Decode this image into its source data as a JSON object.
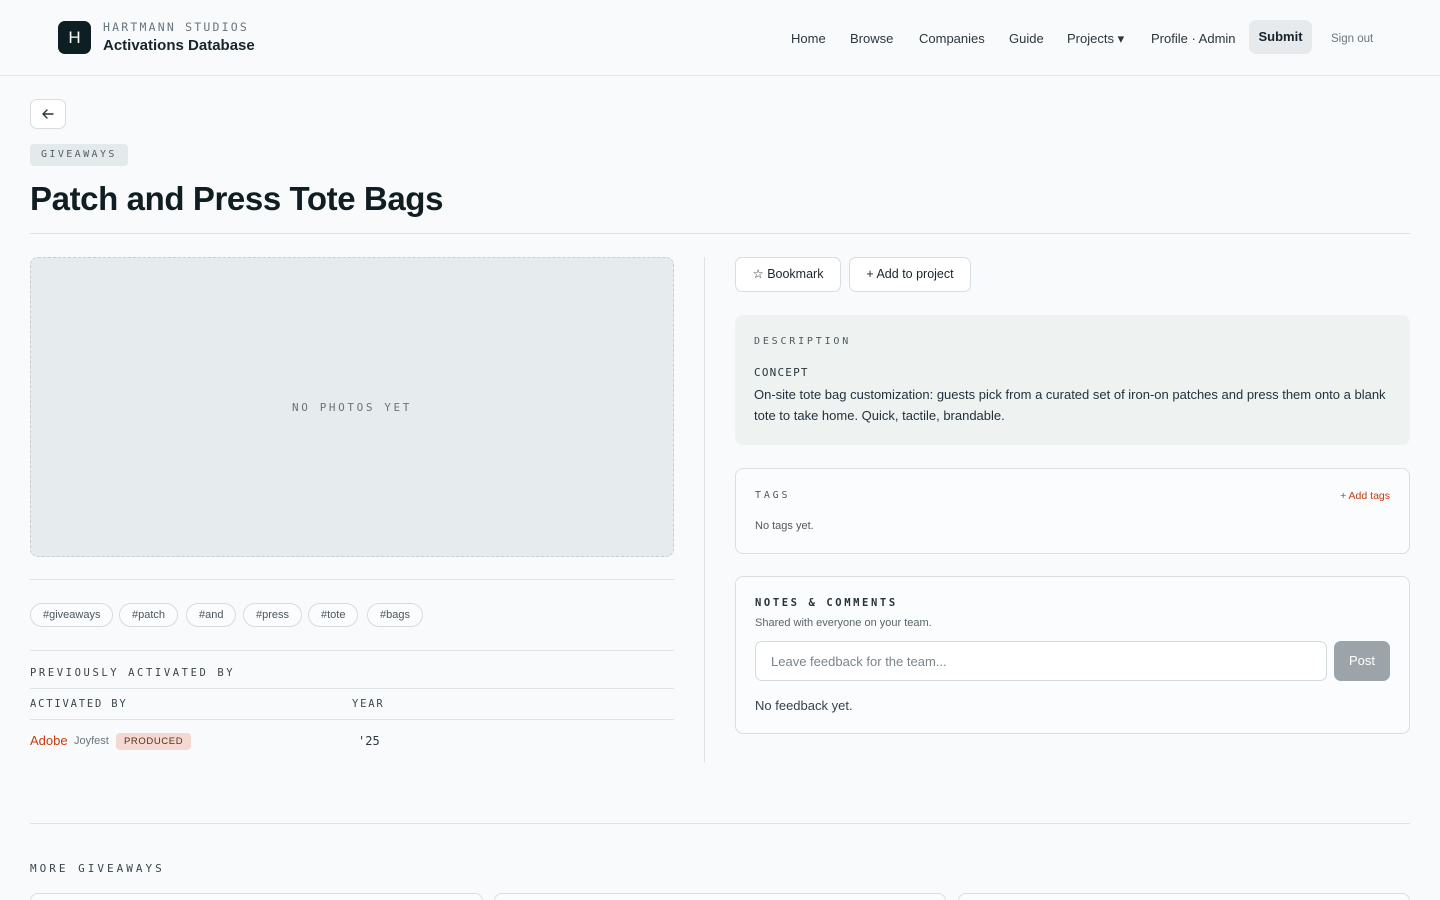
{
  "header": {
    "logo_letter": "H",
    "brand_top": "HARTMANN STUDIOS",
    "brand_bottom": "Activations Database",
    "nav": {
      "home": "Home",
      "browse": "Browse",
      "companies": "Companies",
      "guide": "Guide",
      "projects": "Projects ▾",
      "profile": "Profile · Admin",
      "submit": "Submit",
      "signout": "Sign out"
    }
  },
  "page": {
    "back_icon": "arrow-left-icon",
    "category": "GIVEAWAYS",
    "title": "Patch and Press Tote Bags"
  },
  "gallery": {
    "empty_text": "NO PHOTOS YET"
  },
  "hash_tags": [
    "#giveaways",
    "#patch",
    "#and",
    "#press",
    "#tote",
    "#bags"
  ],
  "activations": {
    "section_label": "PREVIOUSLY ACTIVATED BY",
    "col_activated_by": "ACTIVATED BY",
    "col_year": "YEAR",
    "rows": [
      {
        "company": "Adobe",
        "agency": "Joyfest",
        "status": "PRODUCED",
        "year": "'25"
      }
    ]
  },
  "actions": {
    "bookmark": "☆ Bookmark",
    "add_to_project": "+ Add to project"
  },
  "description": {
    "label": "DESCRIPTION",
    "concept_label": "CONCEPT",
    "concept_text": "On-site tote bag customization: guests pick from a curated set of iron-on patches and press them onto a blank tote to take home. Quick, tactile, brandable."
  },
  "tags": {
    "label": "TAGS",
    "add_link": "+ Add tags",
    "empty_text": "No tags yet."
  },
  "notes": {
    "title": "NOTES & COMMENTS",
    "subtitle": "Shared with everyone on your team.",
    "input_placeholder": "Leave feedback for the team...",
    "post_button": "Post",
    "empty_text": "No feedback yet."
  },
  "more": {
    "label": "MORE GIVEAWAYS"
  },
  "colors": {
    "accent": "#c33d10",
    "dark": "#0d1f22",
    "badge_bg": "#f3d9d1"
  }
}
